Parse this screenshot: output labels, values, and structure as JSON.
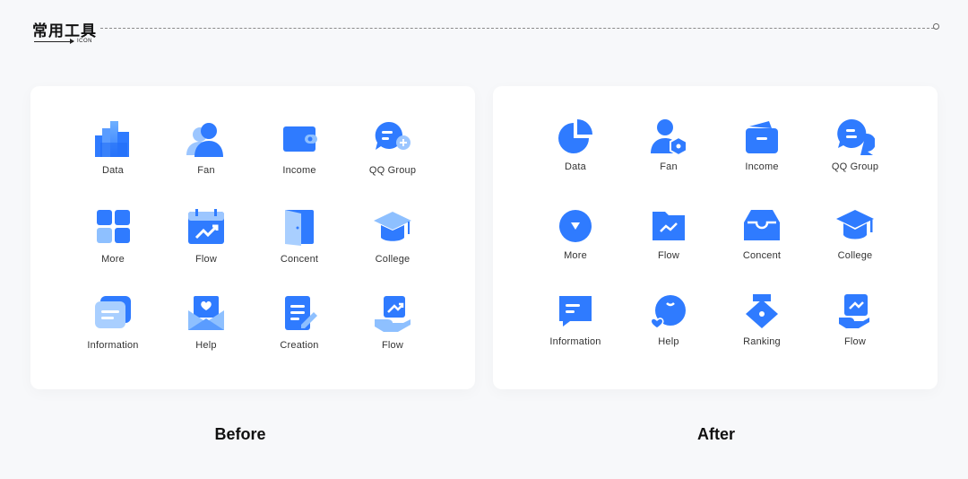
{
  "header": {
    "title": "常用工具",
    "subtitle": "ICON"
  },
  "before": {
    "caption": "Before",
    "items": [
      {
        "label": "Data",
        "icon": "bar-chart-icon"
      },
      {
        "label": "Fan",
        "icon": "user-icon"
      },
      {
        "label": "Income",
        "icon": "wallet-icon"
      },
      {
        "label": "QQ Group",
        "icon": "chat-add-icon"
      },
      {
        "label": "More",
        "icon": "grid-icon"
      },
      {
        "label": "Flow",
        "icon": "calendar-trend-icon"
      },
      {
        "label": "Concent",
        "icon": "door-icon"
      },
      {
        "label": "College",
        "icon": "graduation-cap-icon"
      },
      {
        "label": "Information",
        "icon": "message-icon"
      },
      {
        "label": "Help",
        "icon": "envelope-heart-icon"
      },
      {
        "label": "Creation",
        "icon": "document-pen-icon"
      },
      {
        "label": "Flow",
        "icon": "hand-trend-icon"
      }
    ]
  },
  "after": {
    "caption": "After",
    "items": [
      {
        "label": "Data",
        "icon": "pie-chart-icon"
      },
      {
        "label": "Fan",
        "icon": "user-badge-icon"
      },
      {
        "label": "Income",
        "icon": "wallet-icon"
      },
      {
        "label": "QQ Group",
        "icon": "chat-bubbles-icon"
      },
      {
        "label": "More",
        "icon": "circle-down-icon"
      },
      {
        "label": "Flow",
        "icon": "folder-trend-icon"
      },
      {
        "label": "Concent",
        "icon": "inbox-icon"
      },
      {
        "label": "College",
        "icon": "graduation-cap-icon"
      },
      {
        "label": "Information",
        "icon": "message-icon"
      },
      {
        "label": "Help",
        "icon": "smile-heart-icon"
      },
      {
        "label": "Ranking",
        "icon": "medal-icon"
      },
      {
        "label": "Flow",
        "icon": "hand-trend-icon"
      }
    ]
  },
  "colors": {
    "primary": "#2f7bff",
    "light": "#7fb6ff",
    "pale": "#cfe3ff",
    "background": "#f7f8fa"
  }
}
